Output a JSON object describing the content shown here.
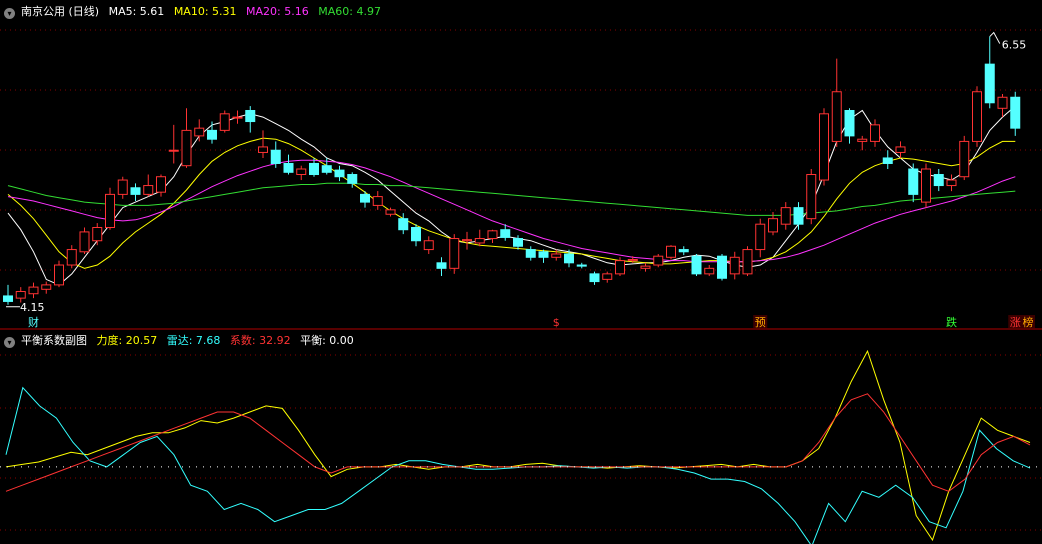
{
  "header": {
    "title": "南京公用 (日线)",
    "indicators": [
      {
        "label": "MA5: 5.61",
        "color": "#ffffff"
      },
      {
        "label": "MA10: 5.31",
        "color": "#ffff00"
      },
      {
        "label": "MA20: 5.16",
        "color": "#ff33ff"
      },
      {
        "label": "MA60: 4.97",
        "color": "#33dd33"
      }
    ],
    "toggle_icon": "chevron-down-icon"
  },
  "sub_header": {
    "title": "平衡系数副图",
    "indicators": [
      {
        "label": "力度: 20.57",
        "color": "#ffff00"
      },
      {
        "label": "雷达: 7.68",
        "color": "#33ffff"
      },
      {
        "label": "系数: 32.92",
        "color": "#ff3333"
      },
      {
        "label": "平衡: 0.00",
        "color": "#ffffff"
      }
    ]
  },
  "chart_data": [
    {
      "type": "candlestick",
      "title": "南京公用 (日线)",
      "up_color": "#ff3333",
      "down_color": "#54ffff",
      "ylim": [
        4.0,
        6.7
      ],
      "price_labels": {
        "max": "6.55",
        "min": "4.15"
      },
      "candles": [
        [
          4.2,
          4.15,
          4.3,
          4.12
        ],
        [
          4.18,
          4.24,
          4.28,
          4.14
        ],
        [
          4.22,
          4.28,
          4.32,
          4.18
        ],
        [
          4.26,
          4.3,
          4.33,
          4.22
        ],
        [
          4.3,
          4.48,
          4.52,
          4.28
        ],
        [
          4.48,
          4.62,
          4.66,
          4.45
        ],
        [
          4.6,
          4.78,
          4.82,
          4.58
        ],
        [
          4.7,
          4.82,
          4.86,
          4.66
        ],
        [
          4.82,
          5.12,
          5.18,
          4.8
        ],
        [
          5.12,
          5.25,
          5.28,
          5.08
        ],
        [
          5.18,
          5.12,
          5.22,
          5.06
        ],
        [
          5.12,
          5.2,
          5.3,
          5.1
        ],
        [
          5.14,
          5.28,
          5.3,
          5.1
        ],
        [
          5.52,
          5.52,
          5.75,
          5.4
        ],
        [
          5.38,
          5.7,
          5.9,
          5.36
        ],
        [
          5.65,
          5.72,
          5.8,
          5.6
        ],
        [
          5.7,
          5.62,
          5.78,
          5.58
        ],
        [
          5.7,
          5.85,
          5.88,
          5.68
        ],
        [
          5.82,
          5.82,
          5.88,
          5.76
        ],
        [
          5.88,
          5.78,
          5.92,
          5.68
        ],
        [
          5.5,
          5.55,
          5.7,
          5.45
        ],
        [
          5.52,
          5.4,
          5.6,
          5.36
        ],
        [
          5.4,
          5.32,
          5.48,
          5.3
        ],
        [
          5.3,
          5.35,
          5.38,
          5.25
        ],
        [
          5.4,
          5.3,
          5.45,
          5.28
        ],
        [
          5.38,
          5.32,
          5.45,
          5.3
        ],
        [
          5.34,
          5.28,
          5.38,
          5.24
        ],
        [
          5.3,
          5.22,
          5.32,
          5.18
        ],
        [
          5.12,
          5.05,
          5.15,
          5.0
        ],
        [
          5.02,
          5.1,
          5.15,
          4.98
        ],
        [
          4.94,
          4.98,
          5.0,
          4.92
        ],
        [
          4.9,
          4.8,
          4.95,
          4.76
        ],
        [
          4.82,
          4.7,
          4.85,
          4.65
        ],
        [
          4.62,
          4.7,
          4.74,
          4.58
        ],
        [
          4.5,
          4.45,
          4.55,
          4.38
        ],
        [
          4.45,
          4.72,
          4.76,
          4.4
        ],
        [
          4.7,
          4.71,
          4.78,
          4.62
        ],
        [
          4.68,
          4.72,
          4.8,
          4.65
        ],
        [
          4.72,
          4.79,
          4.8,
          4.68
        ],
        [
          4.8,
          4.73,
          4.85,
          4.7
        ],
        [
          4.72,
          4.65,
          4.75,
          4.62
        ],
        [
          4.62,
          4.55,
          4.65,
          4.52
        ],
        [
          4.6,
          4.55,
          4.62,
          4.5
        ],
        [
          4.55,
          4.58,
          4.62,
          4.52
        ],
        [
          4.58,
          4.5,
          4.62,
          4.46
        ],
        [
          4.48,
          4.47,
          4.5,
          4.45
        ],
        [
          4.4,
          4.33,
          4.42,
          4.3
        ],
        [
          4.35,
          4.4,
          4.42,
          4.32
        ],
        [
          4.4,
          4.52,
          4.55,
          4.38
        ],
        [
          4.52,
          4.53,
          4.56,
          4.5
        ],
        [
          4.45,
          4.47,
          4.5,
          4.42
        ],
        [
          4.48,
          4.56,
          4.58,
          4.46
        ],
        [
          4.55,
          4.65,
          4.66,
          4.53
        ],
        [
          4.62,
          4.6,
          4.65,
          4.57
        ],
        [
          4.56,
          4.4,
          4.58,
          4.38
        ],
        [
          4.4,
          4.45,
          4.48,
          4.38
        ],
        [
          4.56,
          4.36,
          4.58,
          4.34
        ],
        [
          4.4,
          4.55,
          4.6,
          4.35
        ],
        [
          4.4,
          4.62,
          4.65,
          4.38
        ],
        [
          4.62,
          4.85,
          4.9,
          4.55
        ],
        [
          4.78,
          4.9,
          4.96,
          4.75
        ],
        [
          4.85,
          5.0,
          5.05,
          4.8
        ],
        [
          5.0,
          4.85,
          5.05,
          4.8
        ],
        [
          4.9,
          5.3,
          5.35,
          4.85
        ],
        [
          5.25,
          5.85,
          5.9,
          5.2
        ],
        [
          5.6,
          6.05,
          6.35,
          5.55
        ],
        [
          5.88,
          5.65,
          5.9,
          5.58
        ],
        [
          5.6,
          5.62,
          5.65,
          5.52
        ],
        [
          5.6,
          5.75,
          5.8,
          5.55
        ],
        [
          5.45,
          5.4,
          5.52,
          5.35
        ],
        [
          5.5,
          5.55,
          5.6,
          5.45
        ],
        [
          5.35,
          5.12,
          5.4,
          5.05
        ],
        [
          5.05,
          5.35,
          5.4,
          5.0
        ],
        [
          5.3,
          5.2,
          5.35,
          5.15
        ],
        [
          5.2,
          5.25,
          5.3,
          5.15
        ],
        [
          5.28,
          5.6,
          5.65,
          5.25
        ],
        [
          5.6,
          6.05,
          6.1,
          5.55
        ],
        [
          6.3,
          5.95,
          6.55,
          5.9
        ],
        [
          5.9,
          6.0,
          6.03,
          5.82
        ],
        [
          6.0,
          5.72,
          6.05,
          5.65
        ]
      ],
      "series": [
        {
          "name": "MA5",
          "color": "#ffffff",
          "values": [
            4.95,
            4.8,
            4.6,
            4.35,
            4.3,
            4.4,
            4.55,
            4.7,
            4.85,
            5.0,
            5.05,
            5.1,
            5.15,
            5.28,
            5.48,
            5.65,
            5.75,
            5.78,
            5.82,
            5.85,
            5.82,
            5.76,
            5.7,
            5.62,
            5.55,
            5.45,
            5.4,
            5.38,
            5.32,
            5.25,
            5.15,
            5.05,
            4.95,
            4.88,
            4.78,
            4.7,
            4.68,
            4.7,
            4.72,
            4.74,
            4.72,
            4.7,
            4.66,
            4.62,
            4.6,
            4.58,
            4.54,
            4.5,
            4.48,
            4.49,
            4.5,
            4.5,
            4.52,
            4.55,
            4.57,
            4.56,
            4.52,
            4.48,
            4.46,
            4.48,
            4.55,
            4.7,
            4.85,
            5.02,
            5.3,
            5.6,
            5.8,
            5.88,
            5.7,
            5.55,
            5.45,
            5.35,
            5.3,
            5.28,
            5.25,
            5.32,
            5.5,
            5.7,
            5.82,
            5.92
          ]
        },
        {
          "name": "MA10",
          "color": "#ffff00",
          "values": [
            5.12,
            5.02,
            4.9,
            4.75,
            4.6,
            4.5,
            4.45,
            4.48,
            4.56,
            4.68,
            4.78,
            4.86,
            4.94,
            5.04,
            5.16,
            5.3,
            5.42,
            5.5,
            5.56,
            5.6,
            5.63,
            5.62,
            5.58,
            5.52,
            5.45,
            5.38,
            5.3,
            5.22,
            5.14,
            5.05,
            4.97,
            4.9,
            4.84,
            4.79,
            4.75,
            4.71,
            4.68,
            4.66,
            4.65,
            4.64,
            4.63,
            4.62,
            4.61,
            4.6,
            4.59,
            4.58,
            4.56,
            4.54,
            4.52,
            4.51,
            4.5,
            4.49,
            4.49,
            4.5,
            4.51,
            4.52,
            4.52,
            4.51,
            4.51,
            4.52,
            4.55,
            4.6,
            4.68,
            4.78,
            4.92,
            5.08,
            5.22,
            5.32,
            5.38,
            5.42,
            5.45,
            5.44,
            5.42,
            5.4,
            5.38,
            5.4,
            5.46,
            5.54,
            5.6,
            5.6
          ]
        },
        {
          "name": "MA20",
          "color": "#ff33ff",
          "values": [
            5.1,
            5.08,
            5.06,
            5.03,
            5.0,
            4.97,
            4.94,
            4.91,
            4.89,
            4.88,
            4.89,
            4.92,
            4.96,
            5.01,
            5.07,
            5.13,
            5.19,
            5.24,
            5.29,
            5.33,
            5.37,
            5.4,
            5.42,
            5.43,
            5.43,
            5.42,
            5.41,
            5.39,
            5.36,
            5.32,
            5.28,
            5.23,
            5.18,
            5.13,
            5.08,
            5.03,
            4.98,
            4.93,
            4.88,
            4.84,
            4.8,
            4.76,
            4.72,
            4.69,
            4.66,
            4.63,
            4.61,
            4.59,
            4.57,
            4.55,
            4.54,
            4.53,
            4.52,
            4.52,
            4.51,
            4.51,
            4.51,
            4.51,
            4.51,
            4.52,
            4.53,
            4.55,
            4.58,
            4.62,
            4.66,
            4.71,
            4.76,
            4.81,
            4.86,
            4.9,
            4.94,
            4.97,
            5.0,
            5.03,
            5.06,
            5.1,
            5.14,
            5.19,
            5.24,
            5.28
          ]
        },
        {
          "name": "MA60",
          "color": "#33dd33",
          "values": [
            5.2,
            5.17,
            5.14,
            5.11,
            5.09,
            5.07,
            5.05,
            5.04,
            5.03,
            5.02,
            5.02,
            5.02,
            5.03,
            5.04,
            5.06,
            5.08,
            5.1,
            5.12,
            5.14,
            5.16,
            5.18,
            5.19,
            5.2,
            5.21,
            5.21,
            5.22,
            5.22,
            5.22,
            5.21,
            5.21,
            5.2,
            5.2,
            5.19,
            5.18,
            5.17,
            5.16,
            5.15,
            5.14,
            5.13,
            5.12,
            5.11,
            5.1,
            5.09,
            5.08,
            5.07,
            5.06,
            5.05,
            5.04,
            5.03,
            5.02,
            5.01,
            5.0,
            4.99,
            4.98,
            4.97,
            4.96,
            4.95,
            4.94,
            4.93,
            4.93,
            4.93,
            4.93,
            4.94,
            4.95,
            4.96,
            4.97,
            4.99,
            5.01,
            5.02,
            5.04,
            5.06,
            5.07,
            5.08,
            5.09,
            5.1,
            5.11,
            5.12,
            5.13,
            5.14,
            5.15
          ]
        }
      ],
      "annotations": [
        {
          "text": "财",
          "index": 2,
          "color": "#54ffff"
        },
        {
          "text": "$",
          "index": 43,
          "color": "#ff3333"
        },
        {
          "text": "预",
          "index": 59,
          "color": "#ffaa00",
          "boxed": true
        },
        {
          "text": "跌",
          "index": 74,
          "color": "#33ff33"
        },
        {
          "text": "涨",
          "index": 79,
          "color": "#ff3333",
          "boxed": true
        },
        {
          "text": "榜",
          "index": 80,
          "color": "#ffaa00",
          "boxed": true
        }
      ]
    },
    {
      "type": "line",
      "title": "平衡系数副图",
      "ylim": [
        -60,
        100
      ],
      "series": [
        {
          "name": "力度",
          "color": "#ffff00",
          "values": [
            0,
            2,
            4,
            8,
            12,
            10,
            15,
            20,
            25,
            28,
            28,
            32,
            38,
            36,
            40,
            45,
            50,
            48,
            30,
            10,
            -8,
            -2,
            0,
            0,
            2,
            0,
            -2,
            0,
            0,
            2,
            0,
            0,
            2,
            3,
            1,
            0,
            0,
            -1,
            0,
            1,
            0,
            -1,
            0,
            1,
            2,
            0,
            2,
            0,
            0,
            5,
            15,
            40,
            70,
            95,
            55,
            20,
            -40,
            -60,
            -20,
            10,
            40,
            30,
            25,
            20
          ]
        },
        {
          "name": "雷达",
          "color": "#33ffff",
          "values": [
            10,
            65,
            50,
            40,
            20,
            5,
            0,
            10,
            20,
            25,
            10,
            -15,
            -20,
            -35,
            -30,
            -35,
            -45,
            -40,
            -35,
            -35,
            -30,
            -20,
            -10,
            0,
            5,
            5,
            2,
            0,
            -2,
            -2,
            -1,
            0,
            0,
            1,
            0,
            -1,
            0,
            -1,
            0,
            0,
            -2,
            -5,
            -10,
            -10,
            -12,
            -18,
            -30,
            -45,
            -65,
            -30,
            -45,
            -20,
            -25,
            -15,
            -25,
            -45,
            -50,
            -20,
            30,
            15,
            5,
            -1
          ]
        },
        {
          "name": "系数",
          "color": "#ff3333",
          "values": [
            -20,
            -15,
            -10,
            -5,
            0,
            5,
            10,
            15,
            20,
            25,
            30,
            35,
            40,
            45,
            45,
            40,
            30,
            20,
            10,
            0,
            -5,
            0,
            0,
            0,
            0,
            0,
            0,
            0,
            0,
            0,
            0,
            0,
            0,
            0,
            0,
            0,
            0,
            0,
            0,
            0,
            0,
            0,
            0,
            0,
            0,
            0,
            0,
            0,
            0,
            5,
            20,
            40,
            55,
            60,
            45,
            25,
            5,
            -15,
            -20,
            -10,
            10,
            20,
            25,
            18
          ]
        },
        {
          "name": "平衡",
          "color": "#ffffff",
          "values": [
            0,
            0
          ]
        }
      ]
    }
  ]
}
